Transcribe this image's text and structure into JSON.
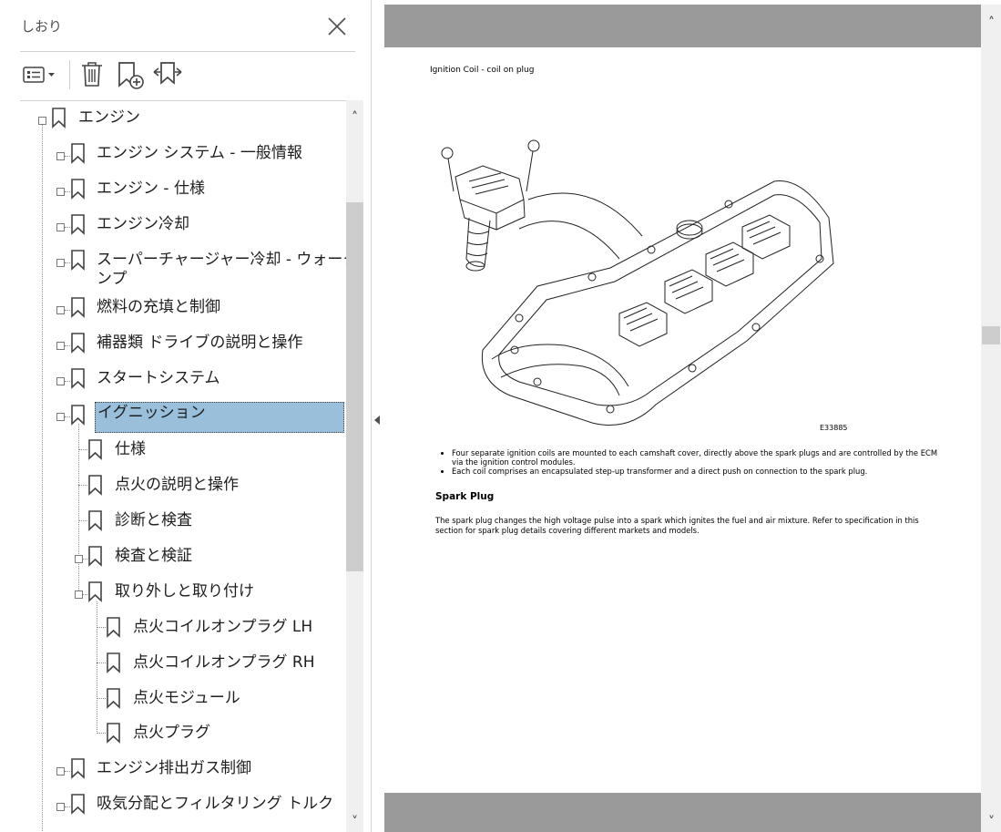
{
  "bookmarks_panel": {
    "title": "しおり",
    "toolbar": {
      "options_icon": "list-options-icon",
      "delete_icon": "trash-icon",
      "new_bookmark_icon": "new-bookmark-icon",
      "expand_icon": "expand-bookmark-icon"
    },
    "items": [
      {
        "label": "エンジン"
      },
      {
        "label": "エンジン システム - 一般情報"
      },
      {
        "label": "エンジン - 仕様"
      },
      {
        "label": "エンジン冷却"
      },
      {
        "label": "スーパーチャージャー冷却 - ウォーターポ",
        "label2": "ンプ"
      },
      {
        "label": "燃料の充填と制御"
      },
      {
        "label": "補器類 ドライブの説明と操作"
      },
      {
        "label": "スタートシステム"
      },
      {
        "label": "イグニッション"
      },
      {
        "label": "仕様"
      },
      {
        "label": "点火の説明と操作"
      },
      {
        "label": "診断と検査"
      },
      {
        "label": "検査と検証"
      },
      {
        "label": "取り外しと取り付け"
      },
      {
        "label": "点火コイルオンプラグ LH"
      },
      {
        "label": "点火コイルオンプラグ RH"
      },
      {
        "label": "点火モジュール"
      },
      {
        "label": "点火プラグ"
      },
      {
        "label": "エンジン排出ガス制御"
      },
      {
        "label": "吸気分配とフィルタリング トルク"
      }
    ]
  },
  "document": {
    "page_header": "Ignition Coil - coil on plug",
    "figure_id": "E33885",
    "bullets": [
      "Four separate ignition coils are mounted to each camshaft cover, directly above the spark plugs and are controlled by the ECM via the ignition control modules.",
      "Each coil comprises an encapsulated step-up transformer and a direct push on connection to the spark plug."
    ],
    "section_heading": "Spark Plug",
    "paragraph": "The spark plug changes the high voltage pulse into a spark which ignites the fuel and air mixture. Refer to specification in this section for spark plug details covering different markets and models."
  }
}
